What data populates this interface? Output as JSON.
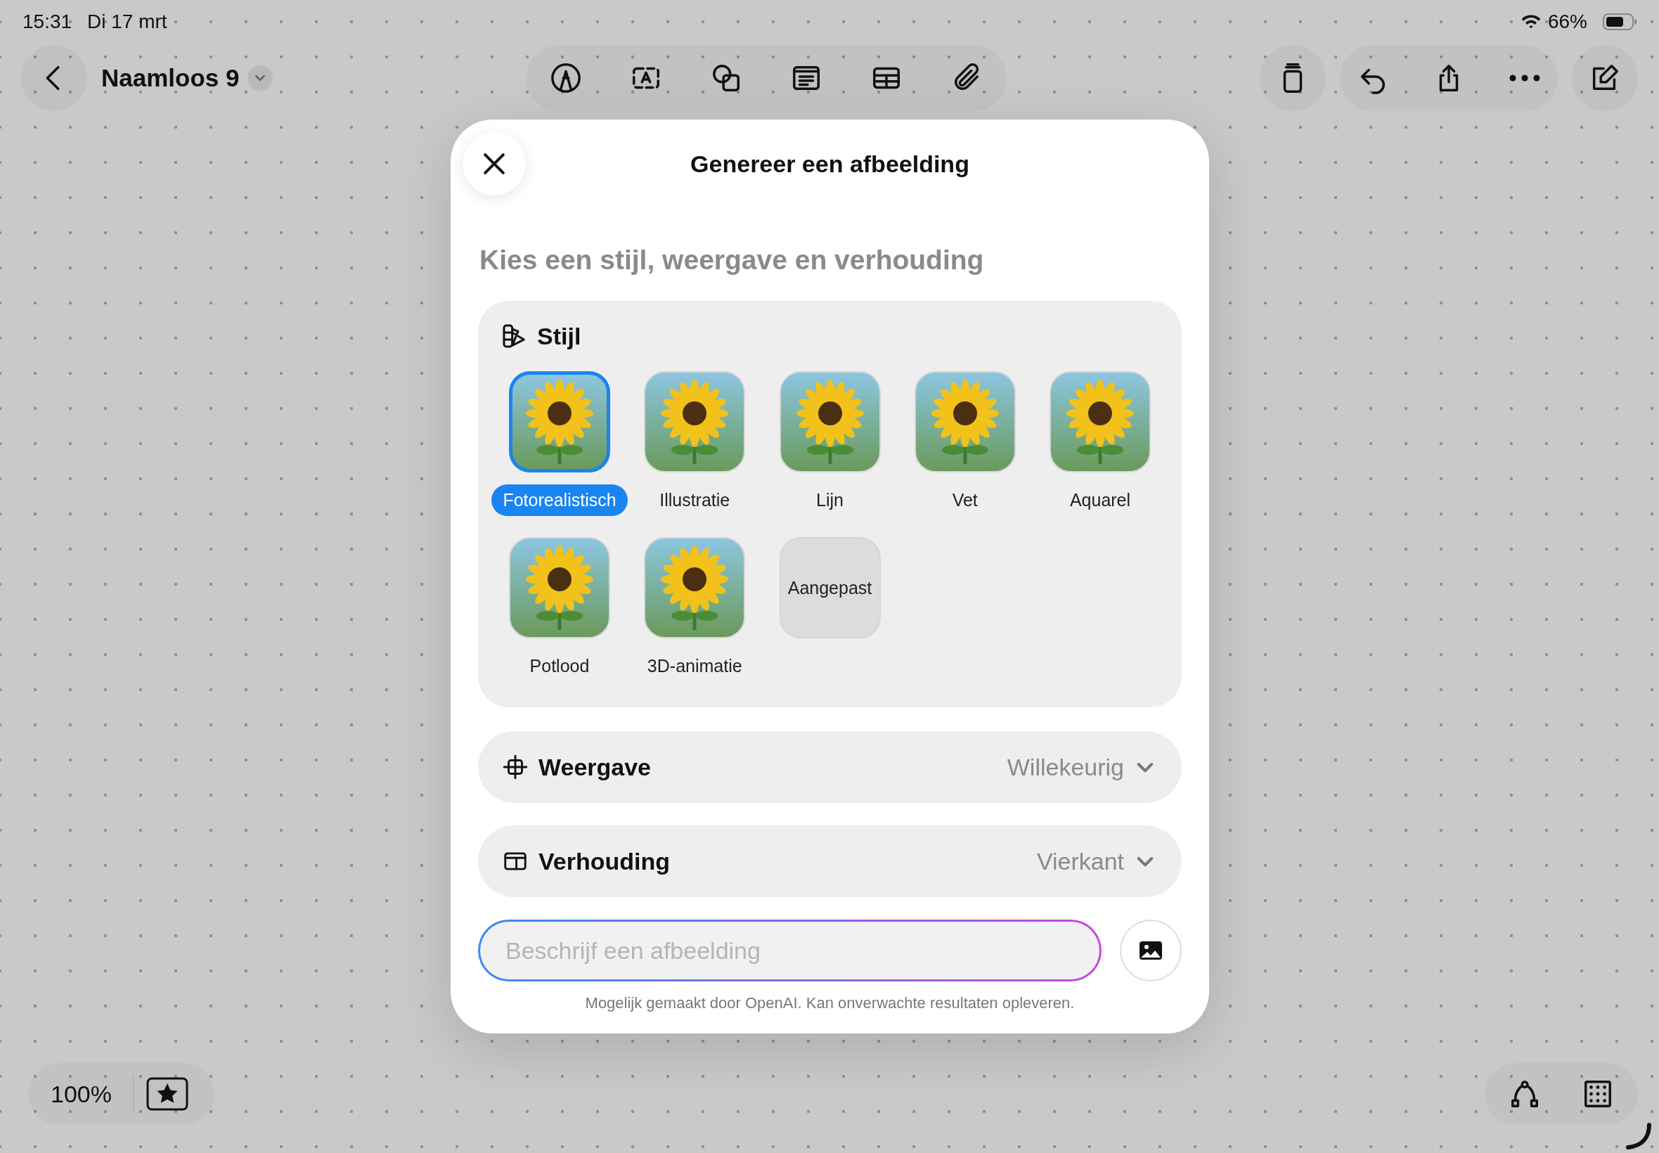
{
  "status_bar": {
    "time": "15:31",
    "date": "Di 17 mrt",
    "battery": "66%"
  },
  "toolbar": {
    "document_title": "Naamloos 9"
  },
  "bottom_bar": {
    "zoom": "100%"
  },
  "dialog": {
    "title": "Genereer een afbeelding",
    "subtitle": "Kies een stijl, weergave en verhouding",
    "style_section": {
      "label": "Stijl",
      "styles": [
        {
          "label": "Fotorealistisch",
          "kind": "image",
          "selected": true
        },
        {
          "label": "Illustratie",
          "kind": "image",
          "selected": false
        },
        {
          "label": "Lijn",
          "kind": "image",
          "selected": false
        },
        {
          "label": "Vet",
          "kind": "image",
          "selected": false
        },
        {
          "label": "Aquarel",
          "kind": "image",
          "selected": false
        },
        {
          "label": "Potlood",
          "kind": "image",
          "selected": false
        },
        {
          "label": "3D-animatie",
          "kind": "image",
          "selected": false
        },
        {
          "label": "Aangepast",
          "kind": "custom",
          "selected": false
        }
      ]
    },
    "options": [
      {
        "kind": "view",
        "label": "Weergave",
        "value": "Willekeurig"
      },
      {
        "kind": "ratio",
        "label": "Verhouding",
        "value": "Vierkant"
      }
    ],
    "prompt": {
      "placeholder": "Beschrijf een afbeelding"
    },
    "disclaimer": "Mogelijk gemaakt door OpenAI. Kan onverwachte resultaten opleveren."
  }
}
